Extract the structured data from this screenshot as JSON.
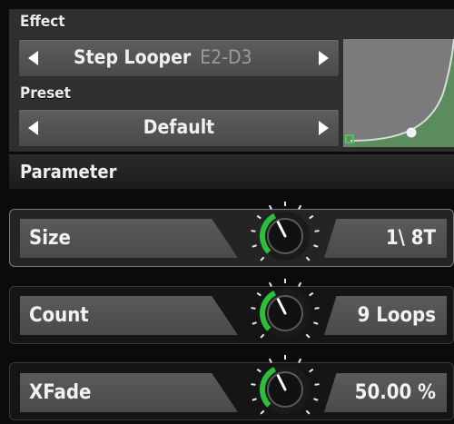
{
  "effect": {
    "label": "Effect",
    "name": "Step Looper",
    "range": "E2-D3"
  },
  "preset": {
    "label": "Preset",
    "name": "Default"
  },
  "parameter_header": "Parameter",
  "params": [
    {
      "name": "Size",
      "value": "1\\ 8T",
      "level": 0.4
    },
    {
      "name": "Count",
      "value": "9 Loops",
      "level": 0.4
    },
    {
      "name": "XFade",
      "value": "50.00 %",
      "level": 0.4
    }
  ],
  "colors": {
    "knob_arc": "#2bbf3a",
    "curve_bg": "#7a7a7a",
    "curve_fill": "#5a8a5c",
    "accent": "#28c840"
  },
  "icons": {
    "prev": "triangle-left-icon",
    "next": "triangle-right-icon",
    "knob": "rotary-knob-icon"
  }
}
